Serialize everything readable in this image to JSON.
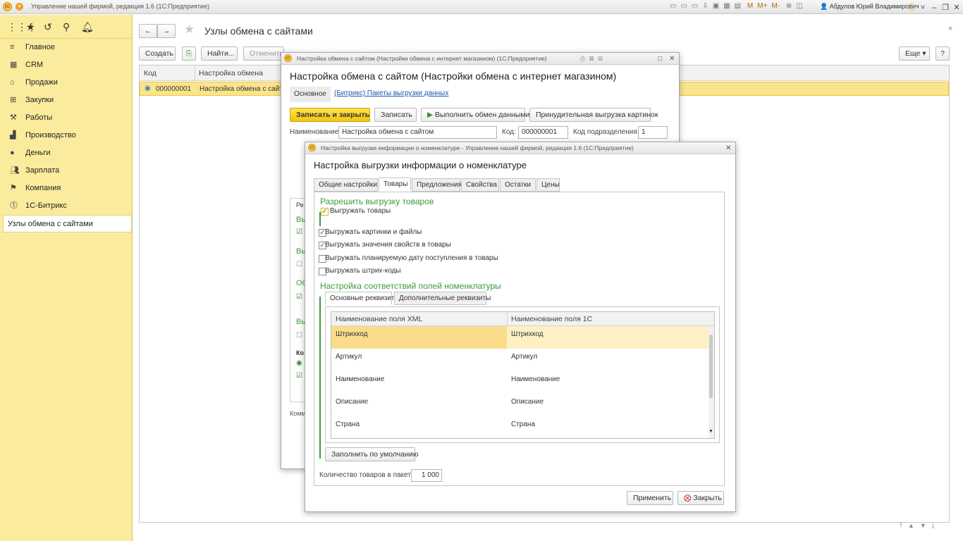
{
  "app": {
    "title": "Управление нашей фирмой, редакция 1.6  (1С:Предприятие)",
    "user": "Абдулов Юрий Владимирович",
    "toolbar_text": [
      "M",
      "M+",
      "M-"
    ]
  },
  "sidebar": {
    "items": [
      {
        "label": "Главное",
        "icon": "menu-icon"
      },
      {
        "label": "CRM",
        "icon": "crm-icon"
      },
      {
        "label": "Продажи",
        "icon": "shop-icon"
      },
      {
        "label": "Закупки",
        "icon": "cart-icon"
      },
      {
        "label": "Работы",
        "icon": "tools-icon"
      },
      {
        "label": "Производство",
        "icon": "factory-icon"
      },
      {
        "label": "Деньги",
        "icon": "money-icon"
      },
      {
        "label": "Зарплата",
        "icon": "people-icon"
      },
      {
        "label": "Компания",
        "icon": "flag-icon"
      },
      {
        "label": "1С-Битрикс",
        "icon": "bitrix-icon"
      }
    ],
    "open_item": "Узлы обмена с сайтами"
  },
  "main": {
    "title": "Узлы обмена с сайтами",
    "btn_create": "Создать",
    "btn_find": "Найти...",
    "btn_cancel": "Отменить",
    "btn_more": "Еще",
    "btn_help": "?",
    "col_code": "Код",
    "col_setting": "Настройка обмена",
    "row_code": "000000001",
    "row_setting": "Настройка обмена с сайтом"
  },
  "win1": {
    "caption": "Настройка обмена с сайтом (Настройки обмена с интернет магазином)  (1С:Предприятие)",
    "title": "Настройка обмена с сайтом (Настройки обмена с интернет магазином)",
    "nav_main": "Основное",
    "nav_link": "(Битрикс) Пакеты выгрузки данных",
    "btn_save_close": "Записать и закрыть",
    "btn_save": "Записать",
    "btn_exchange": "Выполнить обмен данными",
    "btn_force": "Принудительная выгрузка картинок",
    "lbl_name": "Наименование:",
    "val_name": "Настройка обмена с сайтом",
    "lbl_code": "Код:",
    "val_code": "000000001",
    "lbl_div": "Код подразделения:",
    "val_div": "1",
    "frag_re": "Ре",
    "frag_vy1": "Вы",
    "frag_vy2": "Вы",
    "frag_ob": "Об",
    "frag_vy3": "Вы",
    "frag_ko": "Ко",
    "frag_komm": "Комм"
  },
  "win2": {
    "caption": "Настройка выгрузки информации о номенклатуре - Управление нашей фирмой, редакция 1.6  (1С:Предприятие)",
    "title": "Настройка выгрузки информации о номенклатуре",
    "tabs": [
      "Общие настройки",
      "Товары",
      "Предложения",
      "Свойства",
      "Остатки",
      "Цены"
    ],
    "sec_allow": "Разрешить выгрузку товаров",
    "checks": [
      {
        "label": "Выгружать товары",
        "checked": true
      },
      {
        "label": "Выгружать картинки и файлы",
        "checked": true
      },
      {
        "label": "Выгружать значения свойств в товары",
        "checked": true
      },
      {
        "label": "Выгружать планируемую дату поступления в товары",
        "checked": false
      },
      {
        "label": "Выгружать штрих-коды",
        "checked": false
      }
    ],
    "sec_map": "Настройка соответствий полей номенклатуры",
    "subtabs": [
      "Основные реквизиты",
      "Дополнительные реквизиты"
    ],
    "grid_cols": [
      "Наименование поля XML",
      "Наименование поля 1С"
    ],
    "grid_rows": [
      [
        "Штрихкод",
        "Штрихкод"
      ],
      [
        "Артикул",
        "Артикул"
      ],
      [
        "Наименование",
        "Наименование"
      ],
      [
        "Описание",
        "Описание"
      ],
      [
        "Страна",
        "Страна"
      ]
    ],
    "btn_default": "Заполнить по умолчанию",
    "lbl_qty": "Количество товаров в пакете:",
    "val_qty": "1 000",
    "btn_apply": "Применить",
    "btn_close": "Закрыть"
  },
  "colors": {
    "sidebar": "#fbec9d",
    "accent_yellow": "#f5c923",
    "section_green": "#3a9b3a",
    "link": "#2255aa"
  }
}
